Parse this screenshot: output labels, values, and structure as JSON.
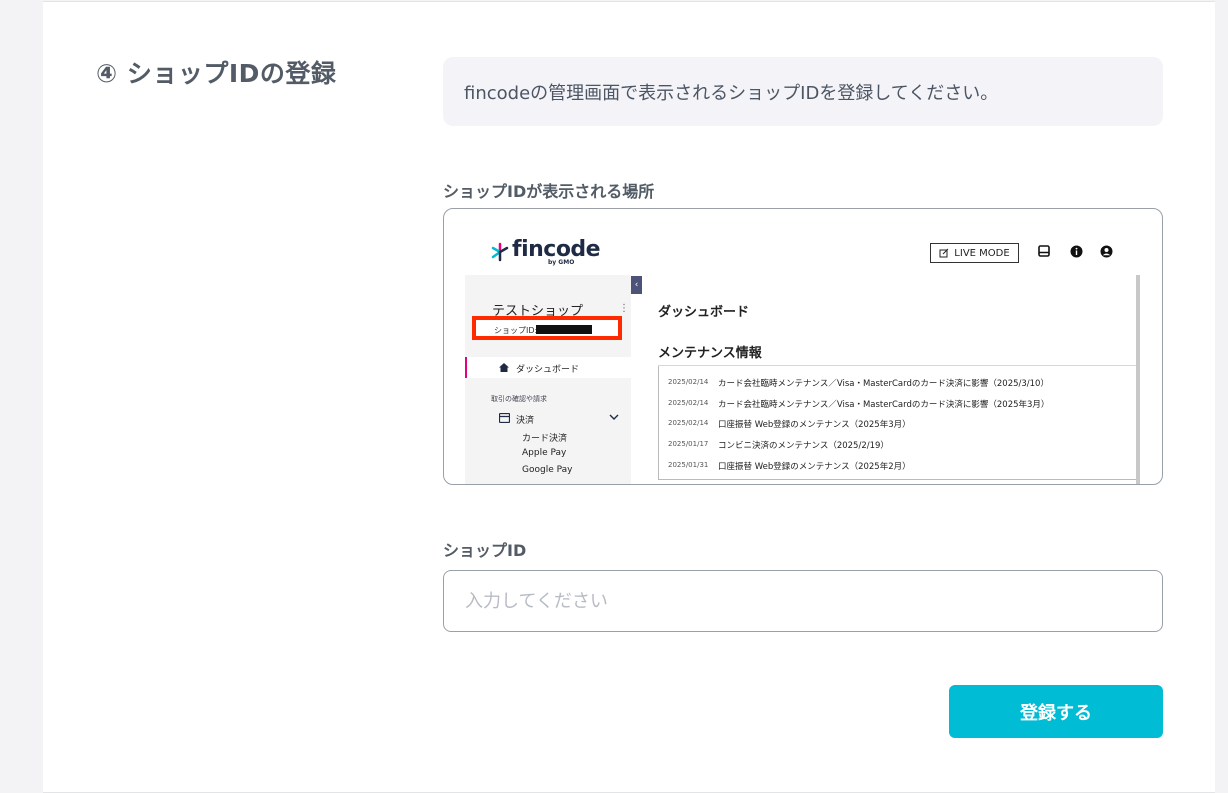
{
  "section": {
    "title": "④ ショップIDの登録",
    "info": "fincodeの管理画面で表示されるショップIDを登録してください。"
  },
  "preview": {
    "label": "ショップIDが表示される場所",
    "logo": "fincode",
    "logo_sub": "by GMO",
    "live_mode": "LIVE MODE",
    "shop_name": "テストショップ",
    "shop_id_label": "ショップID:",
    "nav_dashboard": "ダッシュボード",
    "nav_section": "取引の確認や請求",
    "nav_payment": "決済",
    "nav_sub": [
      "カード決済",
      "Apple Pay",
      "Google Pay"
    ],
    "dashboard_title": "ダッシュボード",
    "maintenance_title": "メンテナンス情報",
    "maintenance_items": [
      {
        "date": "2025/02/14",
        "text": "カード会社臨時メンテナンス／Visa・MasterCardのカード決済に影響（2025/3/10）"
      },
      {
        "date": "2025/02/14",
        "text": "カード会社臨時メンテナンス／Visa・MasterCardのカード決済に影響（2025年3月）"
      },
      {
        "date": "2025/02/14",
        "text": "口座振替 Web登録のメンテナンス（2025年3月）"
      },
      {
        "date": "2025/01/17",
        "text": "コンビニ決済のメンテナンス（2025/2/19）"
      },
      {
        "date": "2025/01/31",
        "text": "口座振替 Web登録のメンテナンス（2025年2月）"
      }
    ]
  },
  "shop_id": {
    "label": "ショップID",
    "placeholder": "入力してください",
    "value": ""
  },
  "submit": {
    "label": "登録する"
  },
  "colors": {
    "accent": "#00bcd4",
    "highlight": "#ff2a00",
    "background": "#f3f3f6"
  }
}
